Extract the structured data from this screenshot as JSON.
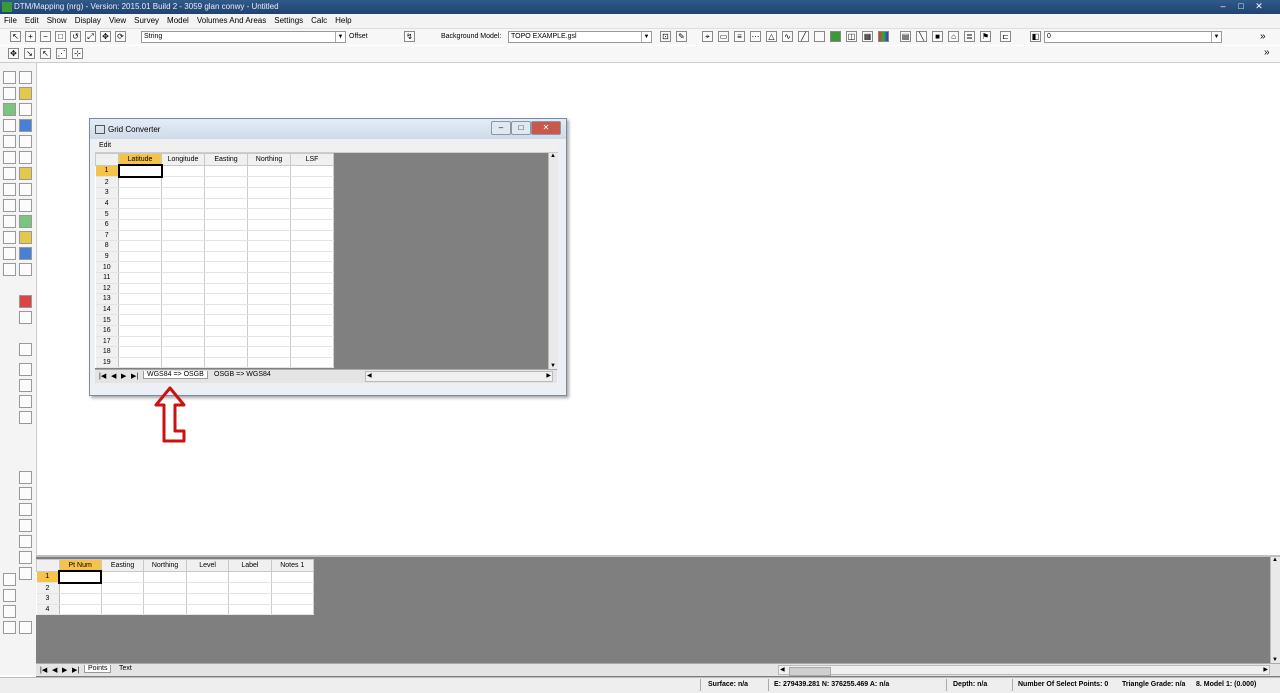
{
  "app": {
    "title": "DTM/Mapping (nrg) - Version: 2015.01 Build 2 - 3059 glan conwy - Untitled",
    "window_controls": [
      "–",
      "□",
      "✕"
    ]
  },
  "menu": [
    "File",
    "Edit",
    "Show",
    "Display",
    "View",
    "Survey",
    "Model",
    "Volumes And Areas",
    "Settings",
    "Calc",
    "Help"
  ],
  "toolbar": {
    "string_label": "String",
    "string_value": "",
    "offset_label": "Offset",
    "background_model_label": "Background Model:",
    "background_model_value": "TOPO EXAMPLE.gsl",
    "layer_value": "0",
    "expand_glyph": "»"
  },
  "grid_converter": {
    "title": "Grid Converter",
    "menu": [
      "Edit"
    ],
    "columns": [
      "Latitude",
      "Longitude",
      "Easting",
      "Northing",
      "LSF"
    ],
    "rows": [
      "1",
      "2",
      "3",
      "4",
      "5",
      "6",
      "7",
      "8",
      "9",
      "10",
      "11",
      "12",
      "13",
      "14",
      "15",
      "16",
      "17",
      "18",
      "19"
    ],
    "tabs": [
      "WGS84 => OSGB",
      "OSGB => WGS84"
    ],
    "active_tab": 0,
    "nav_buttons": [
      "|◀",
      "◀",
      "▶",
      "▶|"
    ],
    "scroll_glyphs": [
      "◀",
      "▶",
      "▲",
      "▼"
    ]
  },
  "points_panel": {
    "columns": [
      "Pt Num",
      "Easting",
      "Northing",
      "Level",
      "Label",
      "Notes 1"
    ],
    "rows": [
      "1",
      "2",
      "3",
      "4"
    ],
    "tabs": [
      "Points",
      "Text"
    ],
    "active_tab": 0,
    "nav_buttons": [
      "|◀",
      "◀",
      "▶",
      "▶|"
    ],
    "scroll_glyphs": [
      "◀",
      "▶",
      "▲",
      "▼"
    ]
  },
  "status": {
    "surface": "Surface: n/a",
    "coords": "E: 279439.281  N: 376255.469  A: n/a",
    "depth": "Depth: n/a",
    "selected": "Number Of Select Points: 0",
    "triangle": "Triangle Grade: n/a",
    "model": "8. Model 1: (0.000)"
  },
  "colors": {
    "title_bar": "#1f4370",
    "selected_header": "#f5c24a",
    "workspace_gray": "#808080",
    "annotation_arrow": "#cc1111"
  }
}
